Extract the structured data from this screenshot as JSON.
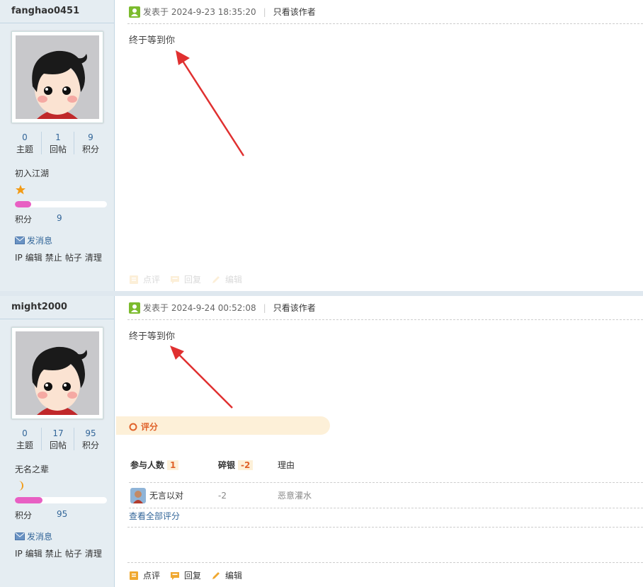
{
  "posts": [
    {
      "username": "fanghao0451",
      "stats": [
        {
          "value": "0",
          "label": "主题"
        },
        {
          "value": "1",
          "label": "回帖"
        },
        {
          "value": "9",
          "label": "积分"
        }
      ],
      "rank_title": "初入江湖",
      "rank_icon": "star-icon",
      "credit_progress": 0.18,
      "credit_label": "积分",
      "credit_value": "9",
      "send_message": "发消息",
      "admin_links": [
        "IP",
        "编辑",
        "禁止",
        "帖子",
        "清理"
      ],
      "posted_prefix": "发表于",
      "posted_time": "2024-9-23 18:35:20",
      "only_author": "只看该作者",
      "content": "终于等到你",
      "actions": [
        "点评",
        "回复",
        "编辑"
      ]
    },
    {
      "username": "might2000",
      "stats": [
        {
          "value": "0",
          "label": "主题"
        },
        {
          "value": "17",
          "label": "回帖"
        },
        {
          "value": "95",
          "label": "积分"
        }
      ],
      "rank_title": "无名之辈",
      "rank_icon": "moon-icon",
      "credit_progress": 0.3,
      "credit_label": "积分",
      "credit_value": "95",
      "send_message": "发消息",
      "admin_links": [
        "IP",
        "编辑",
        "禁止",
        "帖子",
        "清理"
      ],
      "posted_prefix": "发表于",
      "posted_time": "2024-9-24 00:52:08",
      "only_author": "只看该作者",
      "content": "终于等到你",
      "rating": {
        "title": "评分",
        "participants_label": "参与人数",
        "participants_count": "1",
        "silver_label": "碎银",
        "silver_total": "-2",
        "reason_label": "理由",
        "entries": [
          {
            "user": "无言以对",
            "value": "-2",
            "reason": "恶意灌水"
          }
        ],
        "view_all": "查看全部评分"
      },
      "actions": [
        "点评",
        "回复",
        "编辑"
      ]
    }
  ],
  "colors": {
    "sidebar_bg": "#e5edf2",
    "link": "#336699",
    "accent_orange": "#e0622a",
    "progress_pink": "#e85fc3",
    "arrow_red": "#e03030"
  }
}
